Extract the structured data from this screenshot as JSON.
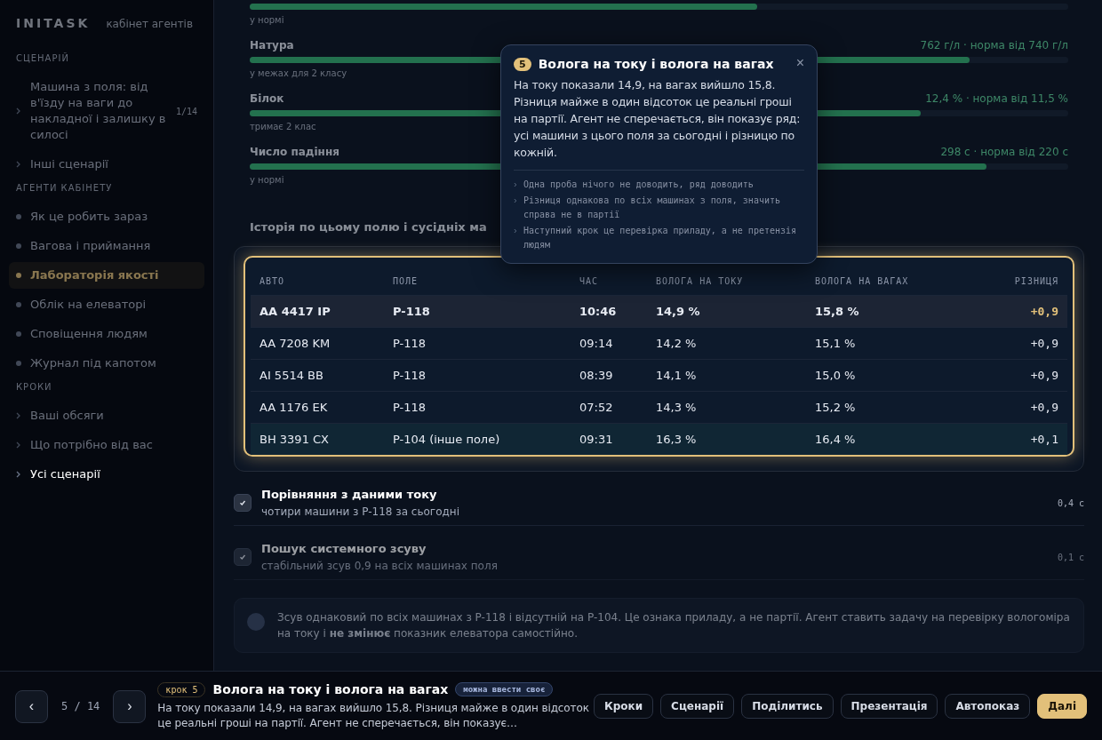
{
  "sidebar": {
    "logo": "INITASK",
    "subtitle": "кабінет агентів",
    "sections": [
      {
        "title": "СЦЕНАРІЙ",
        "kind": "links",
        "items": [
          {
            "label": "Машина з поля: від в'їзду на ваги до накладної і залишку в силосі",
            "count": "1/14",
            "selected": false
          },
          {
            "label": "Інші сценарії",
            "selected": false
          }
        ]
      },
      {
        "title": "АГЕНТИ КАБІНЕТУ",
        "kind": "agents",
        "items": [
          {
            "label": "Як це робить зараз",
            "selected": false
          },
          {
            "label": "Вагова і приймання",
            "selected": false
          },
          {
            "label": "Лабораторія якості",
            "selected": true
          },
          {
            "label": "Облік на елеваторі",
            "selected": false
          },
          {
            "label": "Сповіщення людям",
            "selected": false
          },
          {
            "label": "Журнал під капотом",
            "selected": false
          }
        ]
      },
      {
        "title": "КРОКИ",
        "kind": "links",
        "items": [
          {
            "label": "Ваші обсяги",
            "selected": false
          },
          {
            "label": "Що потрібно від вас",
            "selected": false
          },
          {
            "label": "Усі сценарії",
            "selected": false
          }
        ]
      }
    ]
  },
  "metrics": [
    {
      "level": 0.62,
      "caption": "у нормі"
    },
    {
      "label": "Натура",
      "reading": "762 г/л · норма від 740 г/л",
      "level": 0.88,
      "caption": "у межах для 2 класу"
    },
    {
      "label": "Білок",
      "reading": "12,4 % · норма від 11,5 %",
      "level": 0.82,
      "caption": "тримає 2 клас"
    },
    {
      "label": "Число падіння",
      "reading": "298 с · норма від 220 с",
      "level": 0.9,
      "caption": "у нормі"
    }
  ],
  "history_title": "Історія по цьому полю і сусідніх ма",
  "table": {
    "columns": [
      "АВТО",
      "ПОЛЕ",
      "ЧАС",
      "ВОЛОГА НА ТОКУ",
      "ВОЛОГА НА ВАГАХ",
      "РІЗНИЦЯ"
    ],
    "rows": [
      {
        "cells": [
          "AA 4417 IP",
          "P-118",
          "10:46",
          "14,9 %",
          "15,8 %",
          "+0,9"
        ],
        "selected": true,
        "kind": "same"
      },
      {
        "cells": [
          "AA 7208 KM",
          "P-118",
          "09:14",
          "14,2 %",
          "15,1 %",
          "+0,9"
        ],
        "selected": false,
        "kind": "same"
      },
      {
        "cells": [
          "AI 5514 BB",
          "P-118",
          "08:39",
          "14,1 %",
          "15,0 %",
          "+0,9"
        ],
        "selected": false,
        "kind": "same"
      },
      {
        "cells": [
          "AA 1176 EK",
          "P-118",
          "07:52",
          "14,3 %",
          "15,2 %",
          "+0,9"
        ],
        "selected": false,
        "kind": "same"
      },
      {
        "cells": [
          "BH 3391 CX",
          "P-104 (інше поле)",
          "09:31",
          "16,3 %",
          "16,4 %",
          "+0,1"
        ],
        "selected": false,
        "kind": "other"
      }
    ]
  },
  "steps": [
    {
      "title": "Порівняння з даними току",
      "detail": "чотири машини з P-118 за сьогодні",
      "time": "0,4 с",
      "done": true
    },
    {
      "title": "Пошук системного зсуву",
      "detail": "стабільний зсув 0,9 на всіх машинах поля",
      "time": "0,1 с",
      "done": true
    }
  ],
  "callout": "Зсув однаковий по всіх машинах з P-118 і відсутній на P-104. Це ознака приладу, а не партії. Агент ставить задачу на перевірку вологоміра на току і **не змінює** показник елеватора самостійно.",
  "tooltip": {
    "number": "5",
    "title": "Волога на току і волога на вагах",
    "close": "×",
    "body": "На току показали 14,9, на вагах вийшло 15,8. Різниця майже в один відсоток це реальні гроші на партії. Агент не сперечається, він показує ряд: усі машини з цього поля за сьогодні і різницю по кожній.",
    "notes": [
      "Одна проба нічого не доводить, ряд доводить",
      "Різниця однакова по всіх машинах з поля, значить справа не в партії",
      "Наступний крок це перевірка приладу, а не претензія людям"
    ]
  },
  "footer": {
    "prev": "‹",
    "counter": "5 / 14",
    "next": "›",
    "step_chip": "крок 5",
    "title": "Волога на току і волога на вагах",
    "tag": "можна ввести своє",
    "description": "На току показали 14,9, на вагах вийшло 15,8. Різниця майже в один відсоток це реальні гроші на партії. Агент не сперечається, він показує…",
    "buttons": [
      {
        "label": "Кроки",
        "kind": "secondary"
      },
      {
        "label": "Сценарії",
        "kind": "secondary"
      },
      {
        "label": "Поділитись",
        "kind": "secondary"
      },
      {
        "label": "Презентація",
        "kind": "secondary"
      },
      {
        "label": "Автопоказ",
        "kind": "secondary"
      },
      {
        "label": "Далі",
        "kind": "primary"
      }
    ]
  }
}
